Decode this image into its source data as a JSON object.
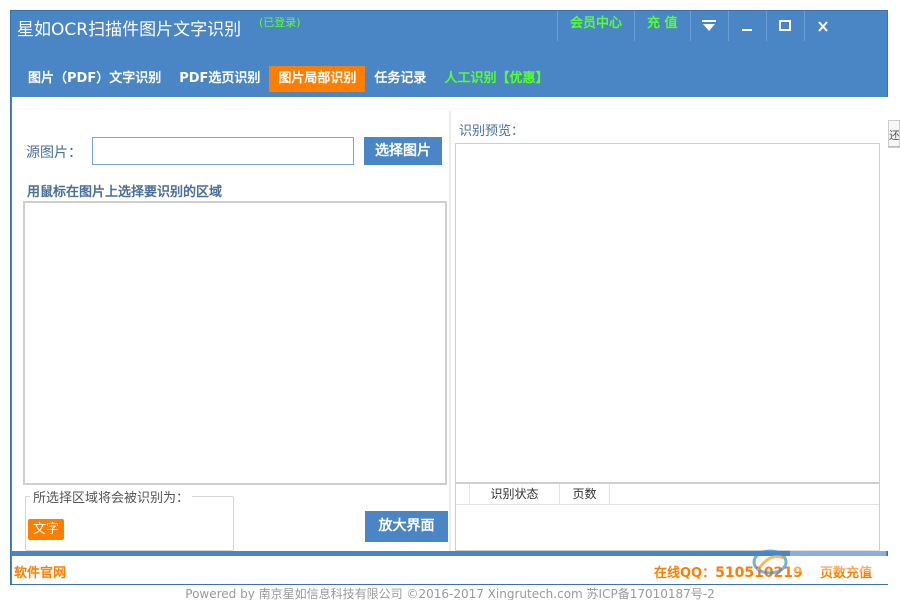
{
  "window": {
    "title": "星如OCR扫描件图片文字识别",
    "login_status": "(已登录)",
    "member_center": "会员中心",
    "recharge": "充 值"
  },
  "nav": {
    "tabs": [
      {
        "label": "图片（PDF）文字识别",
        "active": false
      },
      {
        "label": "PDF选页识别",
        "active": false
      },
      {
        "label": "图片局部识别",
        "active": true
      },
      {
        "label": "任务记录",
        "active": false
      },
      {
        "label": "人工识别【优惠】",
        "active": false
      }
    ]
  },
  "main": {
    "source_label": "源图片：",
    "source_value": "",
    "select_image_button": "选择图片",
    "instruction": "用鼠标在图片上选择要识别的区域",
    "recognize_as_legend": "所选择区域将会被识别为：",
    "recognize_type": "文字",
    "enlarge_button": "放大界面",
    "preview_label": "识别预览：",
    "table_headers": [
      "",
      "识别状态",
      "页数"
    ]
  },
  "status": {
    "official_site": "软件官网",
    "qq_label": "在线QQ：",
    "qq_number": "510510219",
    "page_recharge": "页数充值"
  },
  "footer": {
    "powered": "Powered by 南京星如信息科技有限公司 ©2016-2017 Xingrutech.com 苏ICP备17010187号-2"
  },
  "backdrop": {
    "partial_text": "还"
  },
  "colors": {
    "window_blue": "#4a86c5",
    "accent_orange": "#ff7e00",
    "promo_green": "#56ff2e"
  }
}
